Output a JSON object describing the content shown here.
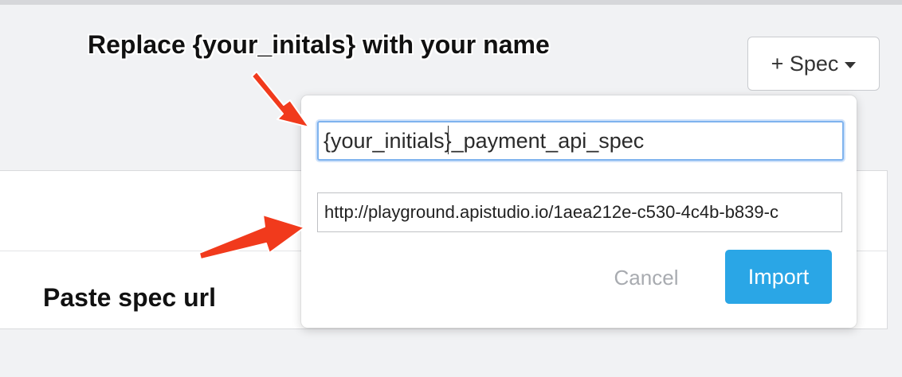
{
  "header": {
    "spec_button_label": "+ Spec",
    "caret_icon": "chevron-down-icon"
  },
  "import_popover": {
    "name_field_value": "{your_initials}_payment_api_spec",
    "url_field_value": "http://playground.apistudio.io/1aea212e-c530-4c4b-b839-c",
    "cancel_label": "Cancel",
    "import_label": "Import"
  },
  "annotations": {
    "replace_note": "Replace {your_initals} with your name",
    "paste_note": "Paste spec url",
    "arrow_color": "#f13a1c"
  },
  "colors": {
    "import_button": "#2aa6e6",
    "focus_ring": "#7fb3ee"
  }
}
